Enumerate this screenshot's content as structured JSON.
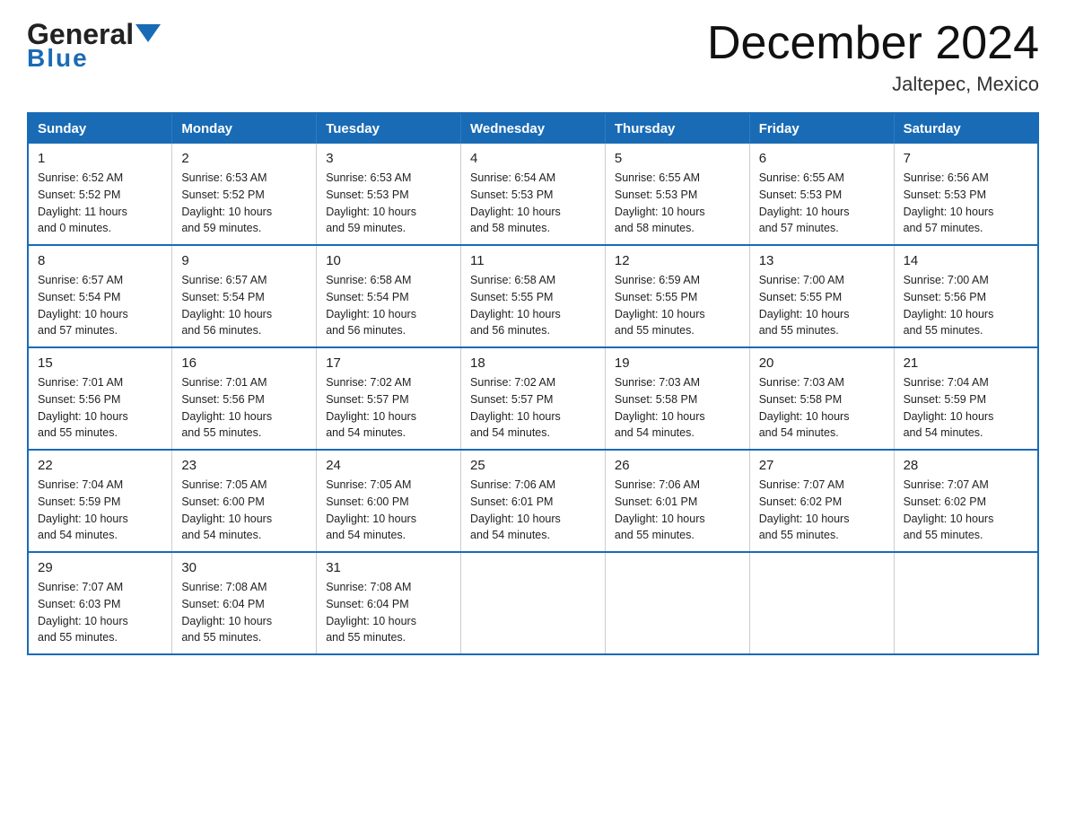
{
  "header": {
    "logo_general": "General",
    "logo_blue": "Blue",
    "month_title": "December 2024",
    "location": "Jaltepec, Mexico"
  },
  "calendar": {
    "days_of_week": [
      "Sunday",
      "Monday",
      "Tuesday",
      "Wednesday",
      "Thursday",
      "Friday",
      "Saturday"
    ],
    "weeks": [
      [
        {
          "day": "1",
          "sunrise": "6:52 AM",
          "sunset": "5:52 PM",
          "daylight": "11 hours and 0 minutes."
        },
        {
          "day": "2",
          "sunrise": "6:53 AM",
          "sunset": "5:52 PM",
          "daylight": "10 hours and 59 minutes."
        },
        {
          "day": "3",
          "sunrise": "6:53 AM",
          "sunset": "5:53 PM",
          "daylight": "10 hours and 59 minutes."
        },
        {
          "day": "4",
          "sunrise": "6:54 AM",
          "sunset": "5:53 PM",
          "daylight": "10 hours and 58 minutes."
        },
        {
          "day": "5",
          "sunrise": "6:55 AM",
          "sunset": "5:53 PM",
          "daylight": "10 hours and 58 minutes."
        },
        {
          "day": "6",
          "sunrise": "6:55 AM",
          "sunset": "5:53 PM",
          "daylight": "10 hours and 57 minutes."
        },
        {
          "day": "7",
          "sunrise": "6:56 AM",
          "sunset": "5:53 PM",
          "daylight": "10 hours and 57 minutes."
        }
      ],
      [
        {
          "day": "8",
          "sunrise": "6:57 AM",
          "sunset": "5:54 PM",
          "daylight": "10 hours and 57 minutes."
        },
        {
          "day": "9",
          "sunrise": "6:57 AM",
          "sunset": "5:54 PM",
          "daylight": "10 hours and 56 minutes."
        },
        {
          "day": "10",
          "sunrise": "6:58 AM",
          "sunset": "5:54 PM",
          "daylight": "10 hours and 56 minutes."
        },
        {
          "day": "11",
          "sunrise": "6:58 AM",
          "sunset": "5:55 PM",
          "daylight": "10 hours and 56 minutes."
        },
        {
          "day": "12",
          "sunrise": "6:59 AM",
          "sunset": "5:55 PM",
          "daylight": "10 hours and 55 minutes."
        },
        {
          "day": "13",
          "sunrise": "7:00 AM",
          "sunset": "5:55 PM",
          "daylight": "10 hours and 55 minutes."
        },
        {
          "day": "14",
          "sunrise": "7:00 AM",
          "sunset": "5:56 PM",
          "daylight": "10 hours and 55 minutes."
        }
      ],
      [
        {
          "day": "15",
          "sunrise": "7:01 AM",
          "sunset": "5:56 PM",
          "daylight": "10 hours and 55 minutes."
        },
        {
          "day": "16",
          "sunrise": "7:01 AM",
          "sunset": "5:56 PM",
          "daylight": "10 hours and 55 minutes."
        },
        {
          "day": "17",
          "sunrise": "7:02 AM",
          "sunset": "5:57 PM",
          "daylight": "10 hours and 54 minutes."
        },
        {
          "day": "18",
          "sunrise": "7:02 AM",
          "sunset": "5:57 PM",
          "daylight": "10 hours and 54 minutes."
        },
        {
          "day": "19",
          "sunrise": "7:03 AM",
          "sunset": "5:58 PM",
          "daylight": "10 hours and 54 minutes."
        },
        {
          "day": "20",
          "sunrise": "7:03 AM",
          "sunset": "5:58 PM",
          "daylight": "10 hours and 54 minutes."
        },
        {
          "day": "21",
          "sunrise": "7:04 AM",
          "sunset": "5:59 PM",
          "daylight": "10 hours and 54 minutes."
        }
      ],
      [
        {
          "day": "22",
          "sunrise": "7:04 AM",
          "sunset": "5:59 PM",
          "daylight": "10 hours and 54 minutes."
        },
        {
          "day": "23",
          "sunrise": "7:05 AM",
          "sunset": "6:00 PM",
          "daylight": "10 hours and 54 minutes."
        },
        {
          "day": "24",
          "sunrise": "7:05 AM",
          "sunset": "6:00 PM",
          "daylight": "10 hours and 54 minutes."
        },
        {
          "day": "25",
          "sunrise": "7:06 AM",
          "sunset": "6:01 PM",
          "daylight": "10 hours and 54 minutes."
        },
        {
          "day": "26",
          "sunrise": "7:06 AM",
          "sunset": "6:01 PM",
          "daylight": "10 hours and 55 minutes."
        },
        {
          "day": "27",
          "sunrise": "7:07 AM",
          "sunset": "6:02 PM",
          "daylight": "10 hours and 55 minutes."
        },
        {
          "day": "28",
          "sunrise": "7:07 AM",
          "sunset": "6:02 PM",
          "daylight": "10 hours and 55 minutes."
        }
      ],
      [
        {
          "day": "29",
          "sunrise": "7:07 AM",
          "sunset": "6:03 PM",
          "daylight": "10 hours and 55 minutes."
        },
        {
          "day": "30",
          "sunrise": "7:08 AM",
          "sunset": "6:04 PM",
          "daylight": "10 hours and 55 minutes."
        },
        {
          "day": "31",
          "sunrise": "7:08 AM",
          "sunset": "6:04 PM",
          "daylight": "10 hours and 55 minutes."
        },
        null,
        null,
        null,
        null
      ]
    ],
    "sunrise_label": "Sunrise:",
    "sunset_label": "Sunset:",
    "daylight_label": "Daylight:"
  }
}
